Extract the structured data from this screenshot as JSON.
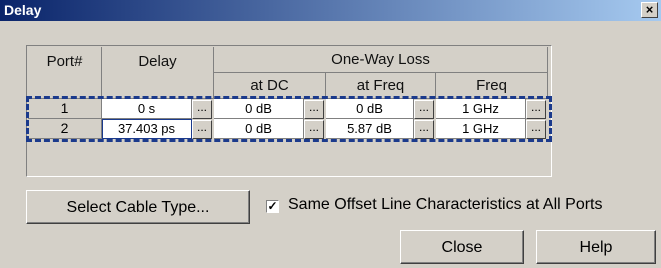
{
  "window": {
    "title": "Delay",
    "close_glyph": "×"
  },
  "table": {
    "headers": {
      "port": "Port#",
      "delay": "Delay",
      "one_way_loss": "One-Way Loss",
      "at_dc": "at DC",
      "at_freq": "at Freq",
      "freq": "Freq"
    },
    "rows": [
      {
        "port": "1",
        "delay": "0 s",
        "loss_dc": "0 dB",
        "loss_freq": "0 dB",
        "freq": "1 GHz"
      },
      {
        "port": "2",
        "delay": "37.403 ps",
        "loss_dc": "0 dB",
        "loss_freq": "5.87 dB",
        "freq": "1 GHz"
      }
    ],
    "ellipsis": "..."
  },
  "buttons": {
    "select_cable": "Select Cable Type...",
    "close": "Close",
    "help": "Help"
  },
  "checkbox": {
    "label": "Same Offset Line Characteristics at All Ports",
    "checked": true,
    "mark": "✓"
  }
}
